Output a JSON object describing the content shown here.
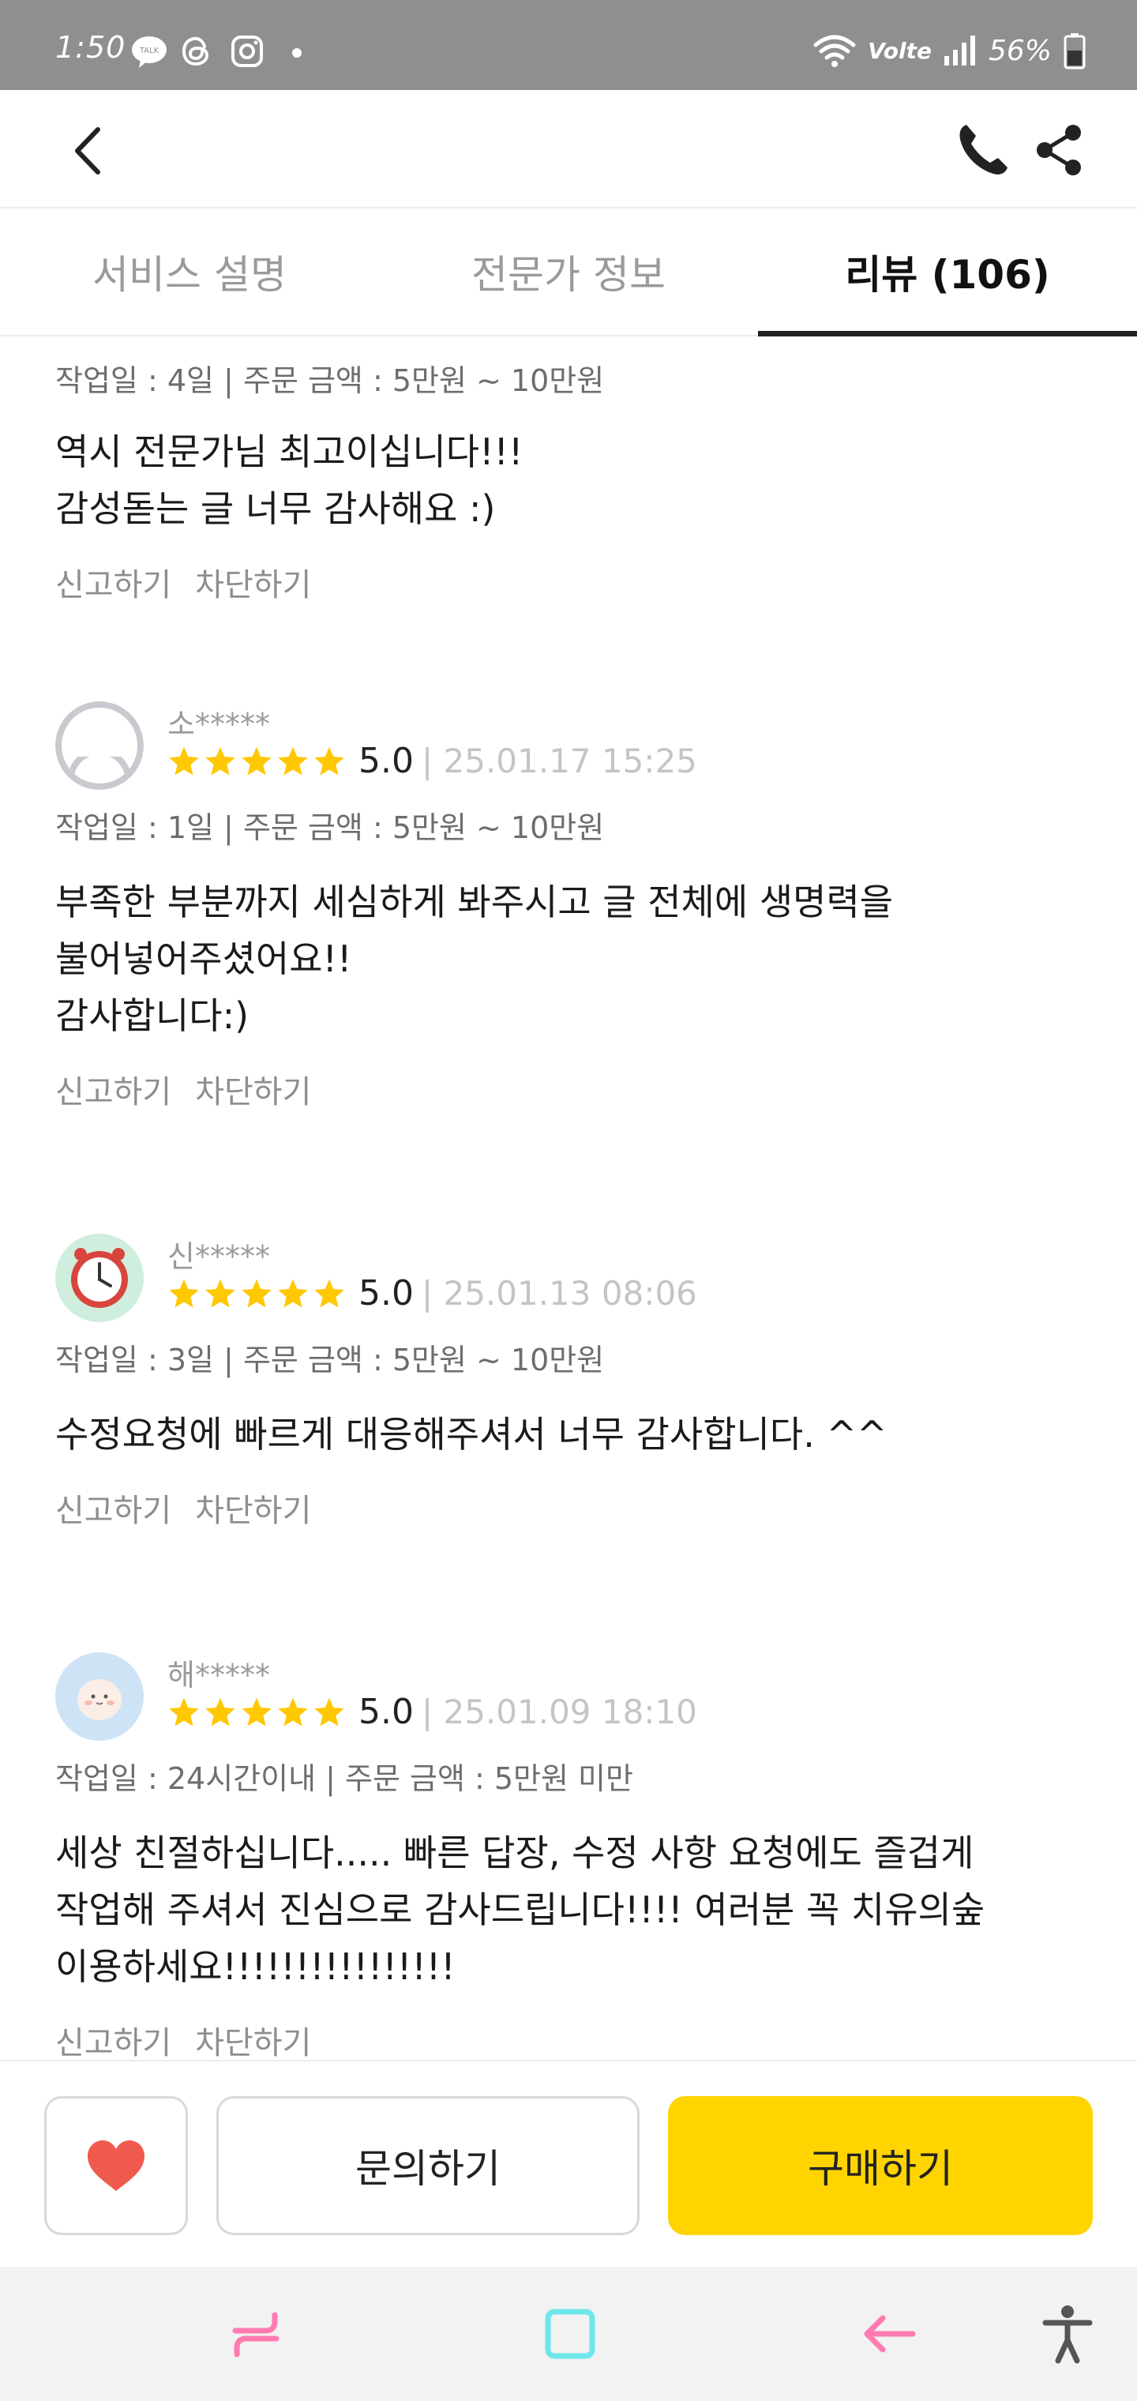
{
  "status_bar": {
    "time": "1:50",
    "signal_label": "Volte",
    "battery": "56%",
    "icons": [
      "talk-icon",
      "threads-icon",
      "instagram-icon",
      "dot-icon",
      "wifi-icon",
      "signal-icon",
      "battery-icon"
    ]
  },
  "header": {
    "icons": [
      "back-icon",
      "phone-icon",
      "share-icon"
    ]
  },
  "tabs": [
    {
      "label": "서비스 설명",
      "active": false
    },
    {
      "label": "전문가 정보",
      "active": false
    },
    {
      "label": "리뷰 (106)",
      "active": true
    }
  ],
  "reviews": [
    {
      "meta": "작업일 : 4일 | 주문 금액 : 5만원 ~ 10만원",
      "content": "역시 전문가님 최고이십니다!!!\n감성돋는 글 너무 감사해요 :)",
      "report": "신고하기",
      "block": "차단하기"
    },
    {
      "name": "소*****",
      "stars": 5,
      "score": "5.0",
      "date": "| 25.01.17 15:25",
      "meta": "작업일 : 1일 | 주문 금액 : 5만원 ~ 10만원",
      "content": "부족한 부분까지 세심하게 봐주시고 글 전체에 생명력을\n불어넣어주셨어요!!\n감사합니다:)",
      "report": "신고하기",
      "block": "차단하기"
    },
    {
      "name": "신*****",
      "stars": 5,
      "score": "5.0",
      "date": "| 25.01.13 08:06",
      "meta": "작업일 : 3일 | 주문 금액 : 5만원 ~ 10만원",
      "content": "수정요청에 빠르게 대응해주셔서 너무 감사합니다. ^^",
      "report": "신고하기",
      "block": "차단하기"
    },
    {
      "name": "해*****",
      "stars": 5,
      "score": "5.0",
      "date": "| 25.01.09 18:10",
      "meta": "작업일 : 24시간이내 | 주문 금액 : 5만원 미만",
      "content": "세상 친절하십니다..... 빠른 답장, 수정 사항 요청에도 즐겁게\n작업해 주셔서 진심으로 감사드립니다!!!! 여러분 꼭 치유의숲\n이용하세요!!!!!!!!!!!!!!!!",
      "report": "신고하기",
      "block": "차단하기"
    }
  ],
  "bottom": {
    "inquire_label": "문의하기",
    "buy_label": "구매하기"
  },
  "colors": {
    "accent": "#ffd400",
    "heart": "#f05a4e",
    "star": "#ffc800"
  }
}
